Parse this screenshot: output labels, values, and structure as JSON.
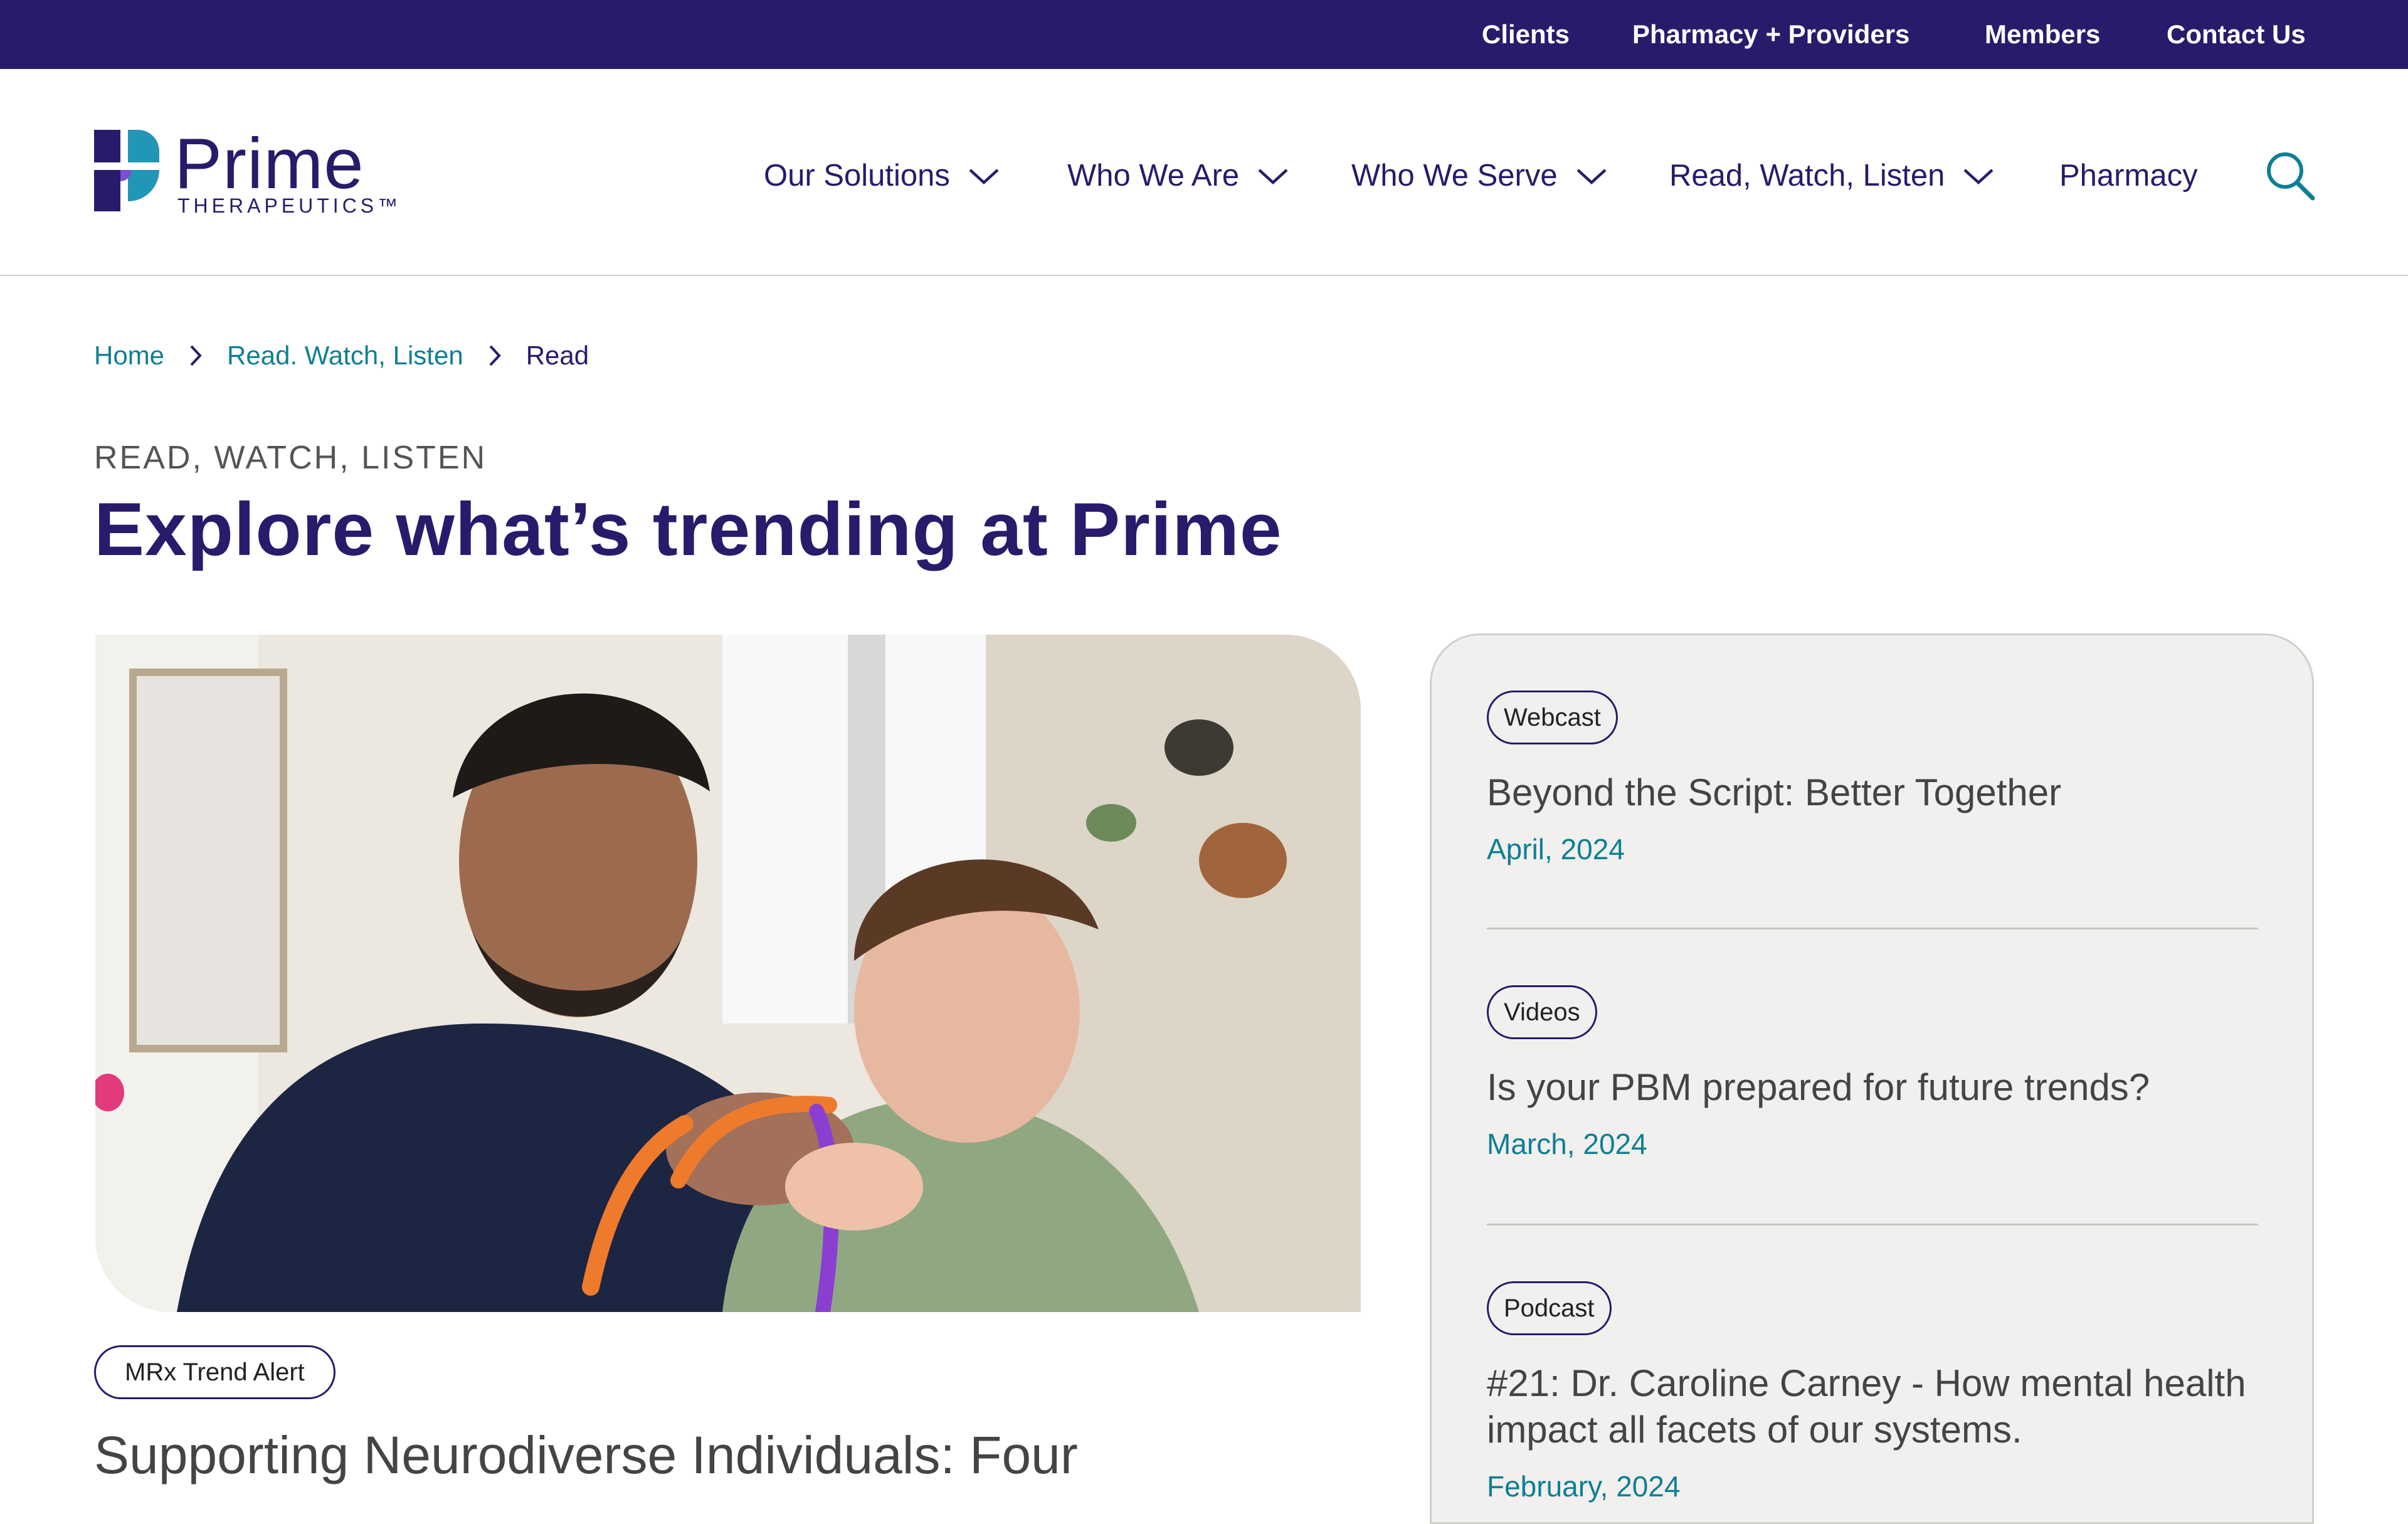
{
  "utility_nav": [
    {
      "label": "Clients"
    },
    {
      "label": "Pharmacy + Providers"
    },
    {
      "label": "Members"
    },
    {
      "label": "Contact Us"
    }
  ],
  "logo": {
    "wordmark": "Prime",
    "subline": "THERAPEUTICS™"
  },
  "main_nav": [
    {
      "label": "Our Solutions",
      "has_dropdown": true
    },
    {
      "label": "Who We Are",
      "has_dropdown": true
    },
    {
      "label": "Who We Serve",
      "has_dropdown": true
    },
    {
      "label": "Read, Watch, Listen",
      "has_dropdown": true
    },
    {
      "label": "Pharmacy",
      "has_dropdown": false
    }
  ],
  "breadcrumb": {
    "items": [
      {
        "label": "Home"
      },
      {
        "label": "Read. Watch, Listen"
      },
      {
        "label": "Read"
      }
    ]
  },
  "hero": {
    "eyebrow": "READ, WATCH, LISTEN",
    "title": "Explore what’s trending at Prime"
  },
  "featured": {
    "tag": "MRx Trend Alert",
    "title": "Supporting Neurodiverse Individuals: Four"
  },
  "sidebar_articles": [
    {
      "tag": "Webcast",
      "title": "Beyond the Script: Better Together",
      "date": "April, 2024"
    },
    {
      "tag": "Videos",
      "title": "Is your PBM prepared for future trends?",
      "date": "March, 2024"
    },
    {
      "tag": "Podcast",
      "title": "#21: Dr. Caroline Carney - How mental health impact all facets of our systems.",
      "date": "February, 2024"
    }
  ],
  "colors": {
    "brand_purple": "#2a1a6b",
    "accent_teal": "#0f7f93",
    "card_bg": "#f1f0ee"
  }
}
